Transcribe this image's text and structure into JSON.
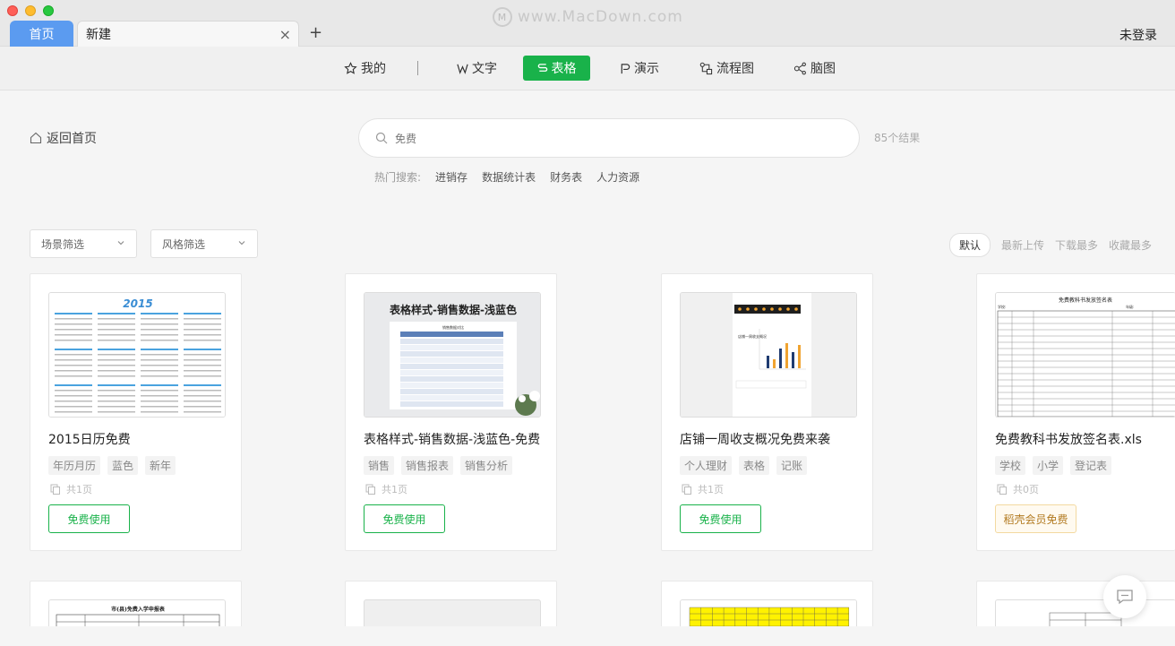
{
  "tabs": {
    "home": "首页",
    "new": "新建",
    "close": "×",
    "add": "+"
  },
  "watermark": "www.MacDown.com",
  "login": "未登录",
  "nav": [
    {
      "label": "我的",
      "icon": "star-icon"
    },
    {
      "label": "文字",
      "icon": "w-icon"
    },
    {
      "label": "表格",
      "icon": "s-icon",
      "active": true
    },
    {
      "label": "演示",
      "icon": "p-icon"
    },
    {
      "label": "流程图",
      "icon": "flowchart-icon"
    },
    {
      "label": "脑图",
      "icon": "mindmap-icon"
    }
  ],
  "back": "返回首页",
  "search": {
    "value": "免费",
    "results": "85个结果"
  },
  "hot": {
    "label": "热门搜索:",
    "keywords": [
      "进销存",
      "数据统计表",
      "财务表",
      "人力资源"
    ]
  },
  "filters": {
    "scene": "场景筛选",
    "style": "风格筛选"
  },
  "sorts": {
    "default": "默认",
    "newest": "最新上传",
    "downloads": "下载最多",
    "favorites": "收藏最多"
  },
  "cards": [
    {
      "title": "2015日历免费",
      "tags": [
        "年历月历",
        "蓝色",
        "新年"
      ],
      "pages": "共1页",
      "button": "免费使用",
      "vip": false
    },
    {
      "title": "表格样式-销售数据-浅蓝色-免费",
      "tags": [
        "销售",
        "销售报表",
        "销售分析"
      ],
      "pages": "共1页",
      "button": "免费使用",
      "vip": false
    },
    {
      "title": "店铺一周收支概况免费来袭",
      "tags": [
        "个人理财",
        "表格",
        "记账"
      ],
      "pages": "共1页",
      "button": "免费使用",
      "vip": false
    },
    {
      "title": "免费教科书发放签名表.xls",
      "tags": [
        "学校",
        "小学",
        "登记表"
      ],
      "pages": "共0页",
      "button": "稻壳会员免费",
      "vip": true
    }
  ],
  "thumbs": {
    "calendar_year": "2015",
    "sales_title": "表格样式-销售数据-浅蓝色",
    "sales_sub": "销售数据对比",
    "store_title": "店铺一周收支概况",
    "sign_title": "免费教科书发放签名表",
    "sign_school": "学校:",
    "sign_grade": "年级:",
    "row2_title": "市(县)免费入学申报表"
  },
  "colors": {
    "accent": "#19b24a",
    "tab_blue": "#5b9bf0"
  }
}
